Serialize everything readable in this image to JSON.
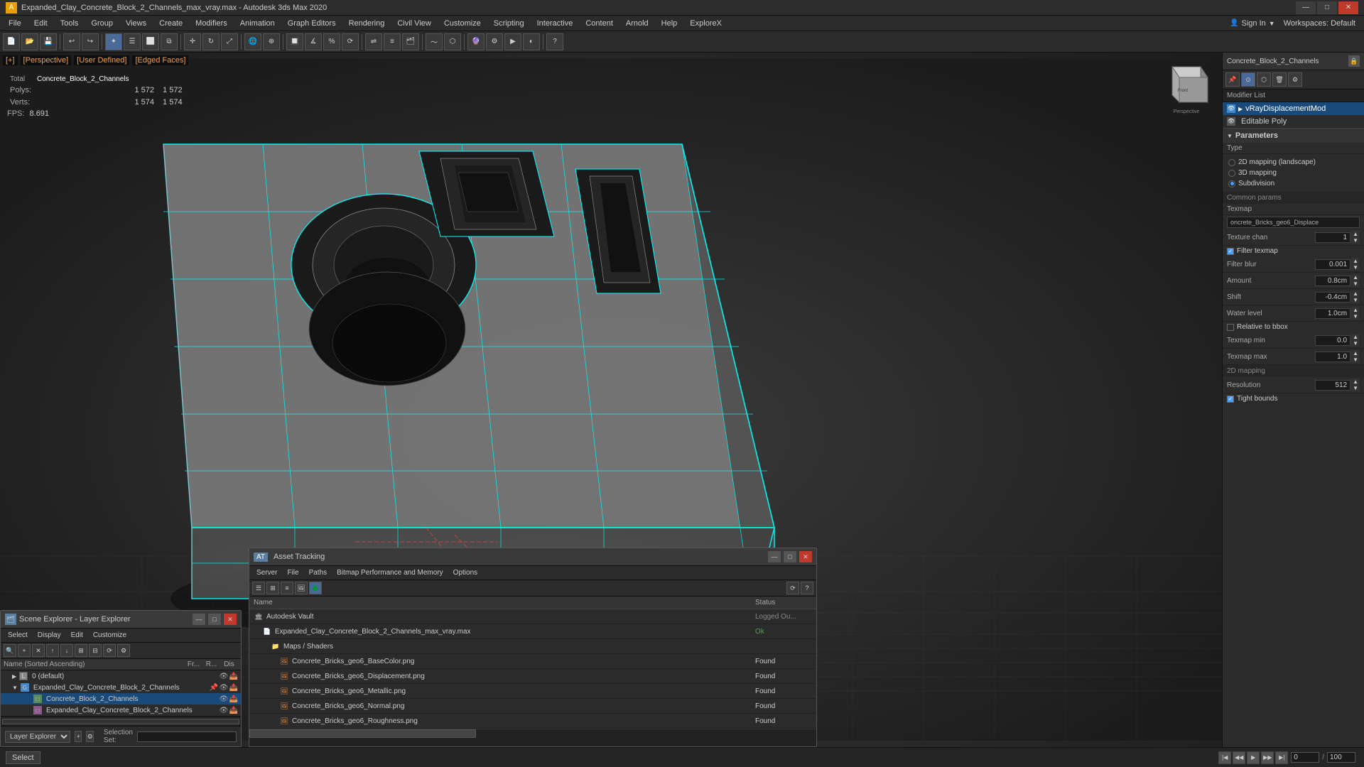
{
  "titleBar": {
    "title": "Expanded_Clay_Concrete_Block_2_Channels_max_vray.max - Autodesk 3ds Max 2020",
    "icon": "A",
    "controls": {
      "minimize": "—",
      "maximize": "□",
      "close": "✕"
    }
  },
  "menuBar": {
    "items": [
      "File",
      "Edit",
      "Tools",
      "Group",
      "Views",
      "Create",
      "Modifiers",
      "Animation",
      "Graph Editors",
      "Rendering",
      "Civil View",
      "Customize",
      "Scripting",
      "Interactive",
      "Content",
      "Arnold",
      "Help",
      "ExploreX"
    ]
  },
  "toolbar": {
    "signinLabel": "Sign In",
    "workspacesLabel": "Workspaces: Default"
  },
  "viewport": {
    "label1": "[+]",
    "label2": "[Perspective]",
    "label3": "[User Defined]",
    "label4": "[Edged Faces]",
    "stats": {
      "polys_label": "Polys:",
      "polys_value": "1 572",
      "polys_total_label": "Total",
      "polys_total": "Concrete_Block_2_Channels",
      "polys_total_val": "1 572",
      "verts_label": "Verts:",
      "verts_value": "1 574",
      "verts_total": "1 574"
    },
    "fps": {
      "label": "FPS:",
      "value": "8.691"
    }
  },
  "rightPanel": {
    "modifierName": "Concrete_Block_2_Channels",
    "modifierListLabel": "Modifier List",
    "modifiers": [
      {
        "name": "vRayDisplacementMod",
        "selected": true
      },
      {
        "name": "Editable Poly",
        "selected": false
      }
    ],
    "parameters": {
      "header": "Parameters",
      "type": {
        "label": "Type",
        "options": [
          {
            "label": "2D mapping (landscape)",
            "checked": false
          },
          {
            "label": "3D mapping",
            "checked": false
          },
          {
            "label": "Subdivision",
            "checked": true
          }
        ]
      },
      "commonParams": "Common params",
      "texmap": {
        "label": "Texmap",
        "value": "oncrete_Bricks_geo6_Displace"
      },
      "textureChan": {
        "label": "Texture chan",
        "value": "1"
      },
      "filterTexmap": {
        "label": "Filter texmap",
        "checked": true
      },
      "filterBlur": {
        "label": "Filter blur",
        "value": "0.001"
      },
      "amount": {
        "label": "Amount",
        "value": "0.8cm"
      },
      "shift": {
        "label": "Shift",
        "value": "-0.4cm"
      },
      "waterLevel": {
        "label": "Water level",
        "value": "1.0cm"
      },
      "relativeToBbox": {
        "label": "Relative to bbox",
        "checked": false
      },
      "texmapMin": {
        "label": "Texmap min",
        "value": "0.0"
      },
      "texmapMax": {
        "label": "Texmap max",
        "value": "1.0"
      },
      "mapping2D": "2D mapping",
      "resolution": {
        "label": "Resolution",
        "value": "512"
      },
      "tightBounds": {
        "label": "Tight bounds",
        "checked": true
      }
    }
  },
  "sceneExplorer": {
    "title": "Scene Explorer - Layer Explorer",
    "menus": [
      "Select",
      "Display",
      "Edit",
      "Customize"
    ],
    "columns": {
      "name": "Name (Sorted Ascending)",
      "fr": "Fr...",
      "r": "R...",
      "dis": "Dis"
    },
    "items": [
      {
        "name": "0 (default)",
        "indent": 1,
        "type": "layer"
      },
      {
        "name": "Expanded_Clay_Concrete_Block_2_Channels",
        "indent": 1,
        "type": "group",
        "expanded": true,
        "color": "blue"
      },
      {
        "name": "Concrete_Block_2_Channels",
        "indent": 2,
        "type": "object",
        "highlighted": true
      },
      {
        "name": "Expanded_Clay_Concrete_Block_2_Channels",
        "indent": 2,
        "type": "object"
      }
    ],
    "footer": {
      "dropdown": "Layer Explorer",
      "selectionSet": "Selection Set:"
    }
  },
  "assetTracking": {
    "title": "Asset Tracking",
    "menus": [
      "Server",
      "File",
      "Paths",
      "Bitmap Performance and Memory",
      "Options"
    ],
    "columns": {
      "name": "Name",
      "status": "Status"
    },
    "items": [
      {
        "name": "Autodesk Vault",
        "indent": 0,
        "type": "vault",
        "status": "Logged Ou..."
      },
      {
        "name": "Expanded_Clay_Concrete_Block_2_Channels_max_vray.max",
        "indent": 1,
        "type": "file",
        "status": "Ok"
      },
      {
        "name": "Maps / Shaders",
        "indent": 2,
        "type": "folder"
      },
      {
        "name": "Concrete_Bricks_geo6_BaseColor.png",
        "indent": 3,
        "type": "texture",
        "status": "Found"
      },
      {
        "name": "Concrete_Bricks_geo6_Displacement.png",
        "indent": 3,
        "type": "texture",
        "status": "Found"
      },
      {
        "name": "Concrete_Bricks_geo6_Metallic.png",
        "indent": 3,
        "type": "texture",
        "status": "Found"
      },
      {
        "name": "Concrete_Bricks_geo6_Normal.png",
        "indent": 3,
        "type": "texture",
        "status": "Found"
      },
      {
        "name": "Concrete_Bricks_geo6_Roughness.png",
        "indent": 3,
        "type": "texture",
        "status": "Found"
      }
    ]
  },
  "statusBar": {
    "selectLabel": "Select"
  }
}
